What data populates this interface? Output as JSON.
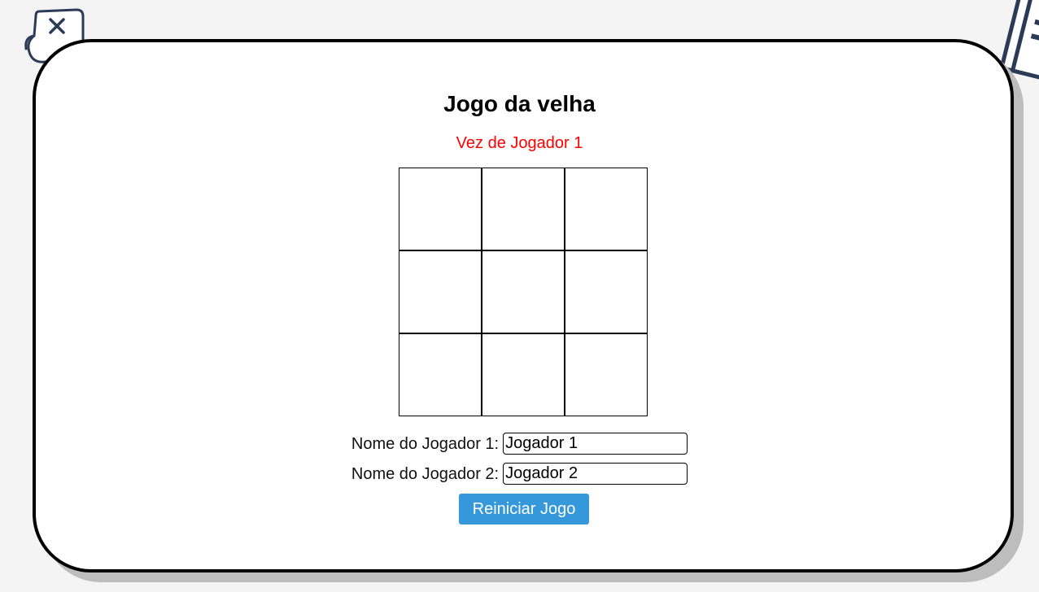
{
  "game": {
    "title": "Jogo da velha",
    "turn_status": "Vez de Jogador 1",
    "board": [
      "",
      "",
      "",
      "",
      "",
      "",
      "",
      "",
      ""
    ]
  },
  "players": {
    "player1_label": "Nome do Jogador 1:",
    "player1_value": "Jogador 1",
    "player2_label": "Nome do Jogador 2:",
    "player2_value": "Jogador 2"
  },
  "actions": {
    "reset_label": "Reiniciar Jogo"
  },
  "decorations": {
    "left_icon": "close-note-icon",
    "right_icon": "notebook-icon",
    "stroke_color": "#2b3a55"
  },
  "colors": {
    "turn_text": "#ff0000",
    "button_bg": "#3498db",
    "card_border": "#000000",
    "page_bg": "#f4f4f4"
  }
}
